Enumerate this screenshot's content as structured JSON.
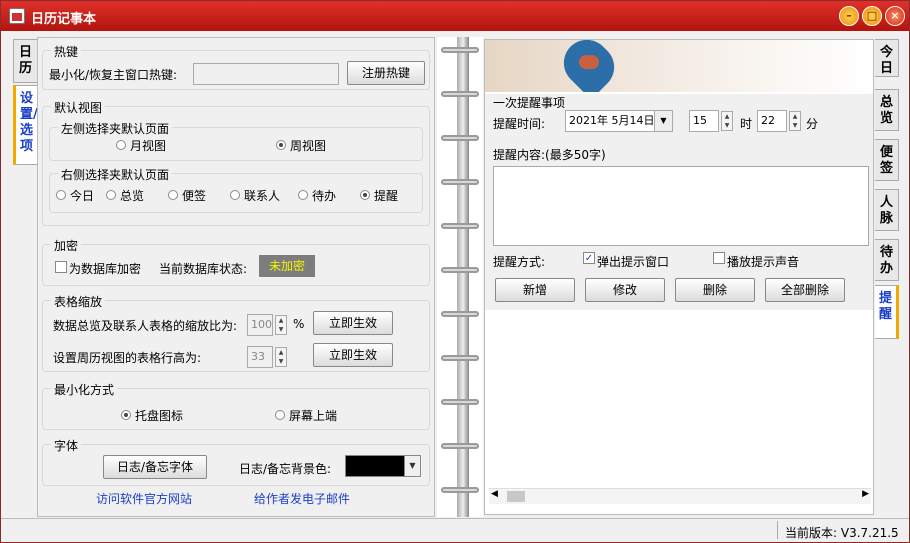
{
  "window": {
    "title": "日历记事本",
    "buttons": {
      "minimize": "–",
      "maximize": "□",
      "close": "×"
    }
  },
  "left_tabs": [
    "日历",
    "设置/选项"
  ],
  "right_tabs": [
    "今日",
    "总览",
    "便签",
    "人脉",
    "待办",
    "提醒"
  ],
  "settings": {
    "hotkey": {
      "title": "热键",
      "label": "最小化/恢复主窗口热键:",
      "value": "",
      "button": "注册热键"
    },
    "default_view": {
      "title": "默认视图",
      "left": {
        "title": "左侧选择夹默认页面",
        "options": [
          "月视图",
          "周视图"
        ],
        "selected": "周视图"
      },
      "right": {
        "title": "右侧选择夹默认页面",
        "options": [
          "今日",
          "总览",
          "便签",
          "联系人",
          "待办",
          "提醒"
        ],
        "selected": "提醒"
      }
    },
    "encrypt": {
      "title": "加密",
      "checkbox": "为数据库加密",
      "checked": false,
      "status_label": "当前数据库状态:",
      "status_value": "未加密",
      "status_color": "#f2f200"
    },
    "table_zoom": {
      "title": "表格缩放",
      "zoom_label": "数据总览及联系人表格的缩放比为:",
      "zoom_value": "100",
      "zoom_unit": "%",
      "zoom_button": "立即生效",
      "row_label": "设置周历视图的表格行高为:",
      "row_value": "33",
      "row_button": "立即生效"
    },
    "minimize": {
      "title": "最小化方式",
      "options": [
        "托盘图标",
        "屏幕上端"
      ],
      "selected": "托盘图标"
    },
    "font": {
      "title": "字体",
      "font_button": "日志/备忘字体",
      "bg_label": "日志/备忘背景色:",
      "bg_color": "#000000"
    },
    "links": {
      "website": "访问软件官方网站",
      "email": "给作者发电子邮件"
    }
  },
  "reminder": {
    "section_title": "一次提醒事项",
    "time_label": "提醒时间:",
    "date_value": "2021年 5月14日",
    "hour_value": "15",
    "hour_unit": "时",
    "minute_value": "22",
    "minute_unit": "分",
    "content_label": "提醒内容:(最多50字)",
    "content_value": "",
    "method_label": "提醒方式:",
    "popup_label": "弹出提示窗口",
    "popup_checked": true,
    "sound_label": "播放提示声音",
    "sound_checked": false,
    "buttons": {
      "add": "新增",
      "edit": "修改",
      "delete": "删除",
      "delete_all": "全部删除"
    }
  },
  "status": {
    "version": "当前版本: V3.7.21.5"
  }
}
